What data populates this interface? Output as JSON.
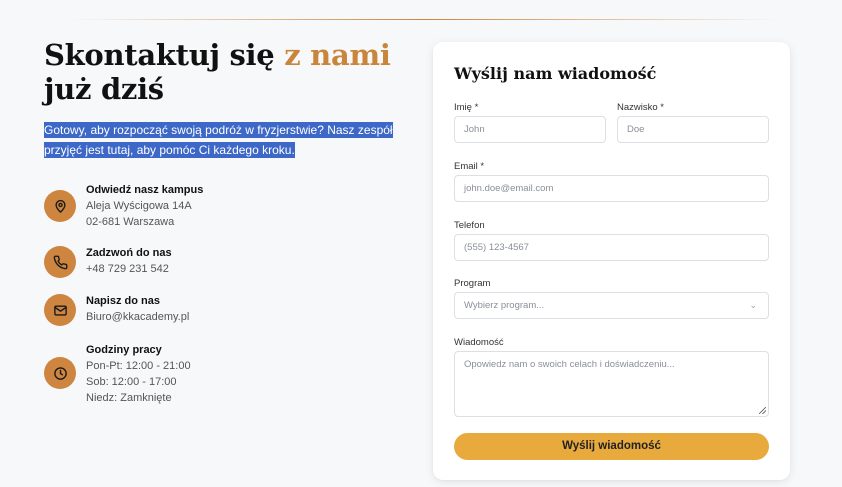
{
  "heading": {
    "part1": "Skontaktuj się ",
    "accent": "z nami",
    "part2": "już dziś"
  },
  "intro": "Gotowy, aby rozpocząć swoją podróż w fryzjerstwie? Nasz zespół przyjęć jest tutaj, aby pomóc Ci każdego kroku.",
  "contacts": [
    {
      "icon": "map-pin-icon",
      "title": "Odwiedź nasz kampus",
      "lines": [
        "Aleja Wyścigowa 14A",
        "02-681 Warszawa"
      ]
    },
    {
      "icon": "phone-icon",
      "title": "Zadzwoń do nas",
      "lines": [
        "+48 729 231 542"
      ]
    },
    {
      "icon": "mail-icon",
      "title": "Napisz do nas",
      "lines": [
        "Biuro@kkacademy.pl"
      ]
    },
    {
      "icon": "clock-icon",
      "title": "Godziny pracy",
      "lines": [
        "Pon-Pt: 12:00 - 21:00",
        "Sob: 12:00 - 17:00",
        "Niedz: Zamknięte"
      ]
    }
  ],
  "form": {
    "title": "Wyślij nam wiadomość",
    "first_name": {
      "label": "Imię *",
      "placeholder": "John"
    },
    "last_name": {
      "label": "Nazwisko *",
      "placeholder": "Doe"
    },
    "email": {
      "label": "Email *",
      "placeholder": "john.doe@email.com"
    },
    "phone": {
      "label": "Telefon",
      "placeholder": "(555) 123-4567"
    },
    "program": {
      "label": "Program",
      "value": "Wybierz program..."
    },
    "message": {
      "label": "Wiadomość",
      "placeholder": "Opowiedz nam o swoich celach i doświadczeniu..."
    },
    "submit_label": "Wyślij wiadomość"
  },
  "colors": {
    "accent": "#cd853f",
    "button": "#e8a93d",
    "selection": "#3d68c8"
  }
}
